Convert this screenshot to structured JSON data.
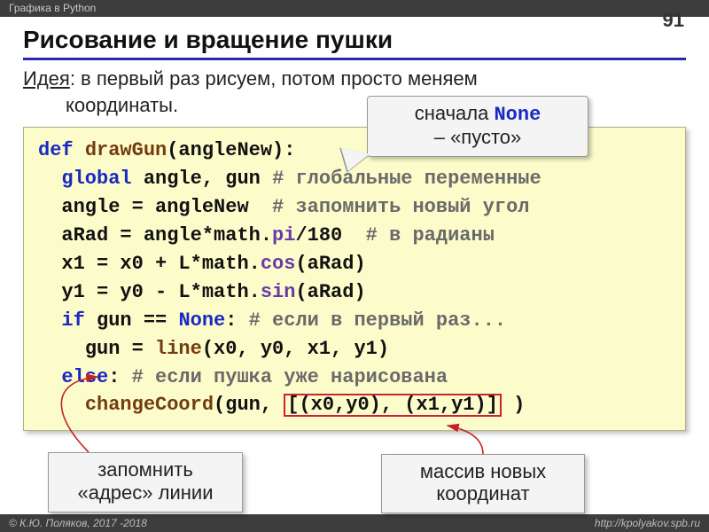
{
  "topbar": {
    "left": "Графика в Python",
    "right": ""
  },
  "pagenum": "91",
  "title": "Рисование и вращение пушки",
  "idea": {
    "label": "Идея",
    "sep": ": ",
    "line1": "в первый раз рисуем, потом просто меняем",
    "line2": "координаты."
  },
  "callouts": {
    "none_l1_a": "сначала ",
    "none_l1_b": "None",
    "none_l2": "– «пусто»",
    "addr_l1": "запомнить",
    "addr_l2": "«адрес» линии",
    "arr_l1": "массив новых",
    "arr_l2": "координат"
  },
  "code": {
    "l1_def": "def ",
    "l1_fn": "drawGun",
    "l1_rest": "(angleNew):",
    "l2_pad": "  ",
    "l2_kw": "global",
    "l2_rest": " angle, gun ",
    "l2_cm": "# глобальные переменные",
    "l3_pad": "  ",
    "l3_rest": "angle = angleNew  ",
    "l3_cm": "# запомнить новый угол",
    "l4_pad": "  ",
    "l4_a": "aRad = angle*math.",
    "l4_pi": "pi",
    "l4_b": "/180  ",
    "l4_cm": "# в радианы",
    "l5_pad": "  ",
    "l5_a": "x1 = x0 + L*math.",
    "l5_fn": "cos",
    "l5_b": "(aRad)",
    "l6_pad": "  ",
    "l6_a": "y1 = y0 - L*math.",
    "l6_fn": "sin",
    "l6_b": "(aRad)",
    "l7_pad": "  ",
    "l7_if": "if",
    "l7_a": " gun == ",
    "l7_none": "None",
    "l7_b": ": ",
    "l7_cm": "# если в первый раз...",
    "l8_pad": "    ",
    "l8_a": "gun = ",
    "l8_fn": "line",
    "l8_b": "(x0, y0, x1, y1)",
    "l9_pad": "  ",
    "l9_else": "else",
    "l9_a": ": ",
    "l9_cm": "# если пушка уже нарисована",
    "l10_pad": "    ",
    "l10_fn": "changeCoord",
    "l10_a": "(gun, ",
    "l10_hl": "[(x0,y0), (x1,y1)]",
    "l10_b": " )"
  },
  "footer": {
    "left": "© К.Ю. Поляков, 2017 -2018",
    "right": "http://kpolyakov.spb.ru"
  }
}
